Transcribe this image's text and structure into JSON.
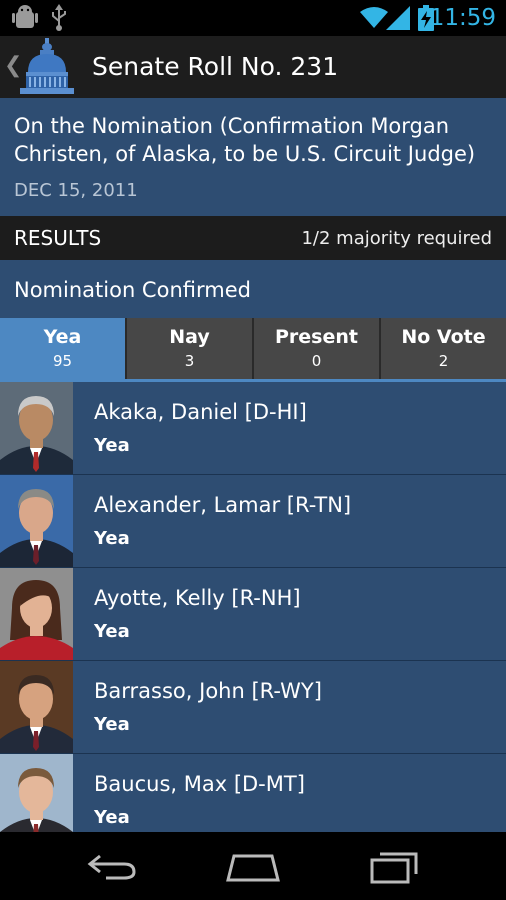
{
  "status": {
    "time": "11:59",
    "icons": [
      "android-debug-icon",
      "usb-icon",
      "wifi-icon",
      "signal-icon",
      "battery-charging-icon"
    ]
  },
  "actionbar": {
    "title": "Senate Roll No. 231",
    "icons": [
      "back-caret-icon",
      "capitol-dome-icon"
    ]
  },
  "vote": {
    "question": "On the Nomination (Confirmation Morgan Christen, of Alaska, to be U.S. Circuit Judge)",
    "date": "DEC 15, 2011",
    "results_label": "RESULTS",
    "majority": "1/2 majority required",
    "outcome": "Nomination Confirmed"
  },
  "tabs": [
    {
      "label": "Yea",
      "count": "95"
    },
    {
      "label": "Nay",
      "count": "3"
    },
    {
      "label": "Present",
      "count": "0"
    },
    {
      "label": "No Vote",
      "count": "2"
    }
  ],
  "senators": [
    {
      "name": "Akaka, Daniel [D-HI]",
      "vote": "Yea",
      "colors": {
        "bg": "#5d6b78",
        "hair": "#c9c9c9",
        "skin": "#b98a64",
        "suit": "#1e2a3a",
        "tie": "#b02a2a"
      }
    },
    {
      "name": "Alexander, Lamar [R-TN]",
      "vote": "Yea",
      "colors": {
        "bg": "#3a6aa8",
        "hair": "#8a8a86",
        "skin": "#d9a78a",
        "suit": "#1c2636",
        "tie": "#6b1f2a"
      }
    },
    {
      "name": "Ayotte, Kelly [R-NH]",
      "vote": "Yea",
      "colors": {
        "bg": "#8f8f8f",
        "hair": "#4a2a1c",
        "skin": "#e2b294",
        "suit": "#b81f2a",
        "tie": "#b81f2a"
      }
    },
    {
      "name": "Barrasso, John [R-WY]",
      "vote": "Yea",
      "colors": {
        "bg": "#5a3a24",
        "hair": "#3a2a22",
        "skin": "#d6a27f",
        "suit": "#222a3a",
        "tie": "#7a1f2a"
      }
    },
    {
      "name": "Baucus, Max [D-MT]",
      "vote": "Yea",
      "colors": {
        "bg": "#9fb6cc",
        "hair": "#7a5a3c",
        "skin": "#e4b79a",
        "suit": "#2a2a30",
        "tie": "#8a2a2a"
      }
    }
  ],
  "navbar": {
    "icons": [
      "back-nav-icon",
      "home-nav-icon",
      "recents-nav-icon"
    ]
  }
}
